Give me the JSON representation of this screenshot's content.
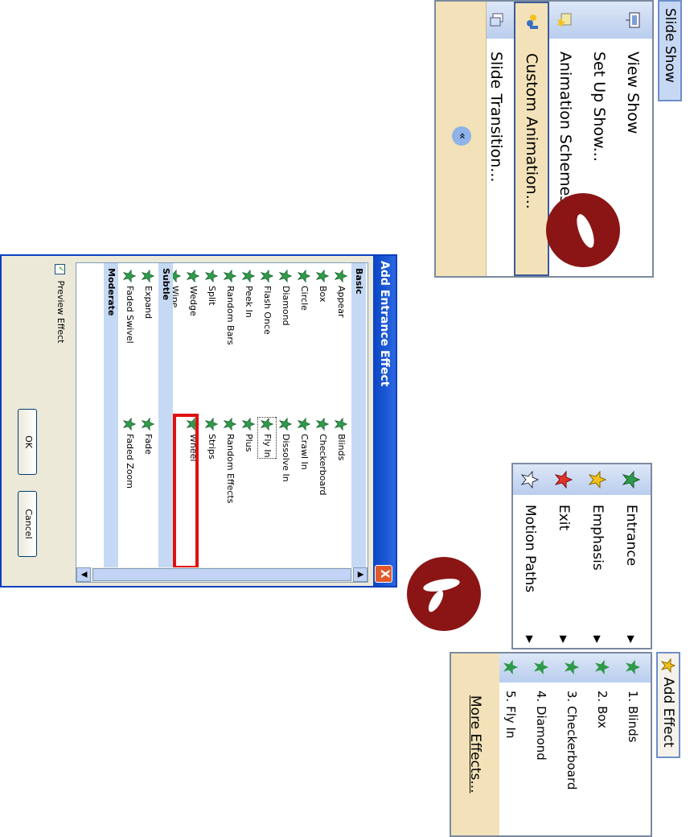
{
  "slideshow": {
    "tab_label": "Slide Show",
    "items": [
      {
        "label": "View Show",
        "icon": "view-show-icon"
      },
      {
        "label": "Set Up Show...",
        "icon": "setup-show-icon"
      },
      {
        "label": "Animation Schemes...",
        "icon": "animation-schemes-icon"
      },
      {
        "label": "Custom Animation...",
        "icon": "custom-animation-icon"
      },
      {
        "label": "Slide Transition...",
        "icon": "slide-transition-icon"
      }
    ],
    "chevron": "«"
  },
  "dialog": {
    "title": "Add Entrance Effect",
    "close_glyph": "X",
    "categories": {
      "basic": "Basic",
      "subtle": "Subtle",
      "moderate": "Moderate"
    },
    "basic_left": [
      "Appear",
      "Box",
      "Circle",
      "Diamond",
      "Flash Once",
      "Peek In",
      "Random Bars",
      "Split",
      "Wedge",
      "Wipe"
    ],
    "basic_right": [
      "Blinds",
      "Checkerboard",
      "Crawl In",
      "Dissolve In",
      "Fly In",
      "Plus",
      "Random Effects",
      "Strips",
      "Wheel"
    ],
    "subtle_left": [
      "Expand",
      "Faded Swivel"
    ],
    "subtle_right": [
      "Fade",
      "Faded Zoom"
    ],
    "selected": "Fly In",
    "preview_label": "Preview Effect",
    "ok_label": "OK",
    "cancel_label": "Cancel"
  },
  "add_effect": {
    "button_label": "Add Effect",
    "menu": [
      {
        "label": "Entrance",
        "icon": "entrance-star-icon"
      },
      {
        "label": "Emphasis",
        "icon": "emphasis-star-icon"
      },
      {
        "label": "Exit",
        "icon": "exit-star-icon"
      },
      {
        "label": "Motion Paths",
        "icon": "motion-path-star-icon"
      }
    ],
    "submenu": [
      "1. Blinds",
      "2. Box",
      "3. Checkerboard",
      "4. Diamond",
      "5. Fly In"
    ],
    "more_effects": "More Effects..."
  },
  "colors": {
    "accent": "#0a45c7",
    "highlight": "#e01010",
    "badge": "#8b1515"
  }
}
